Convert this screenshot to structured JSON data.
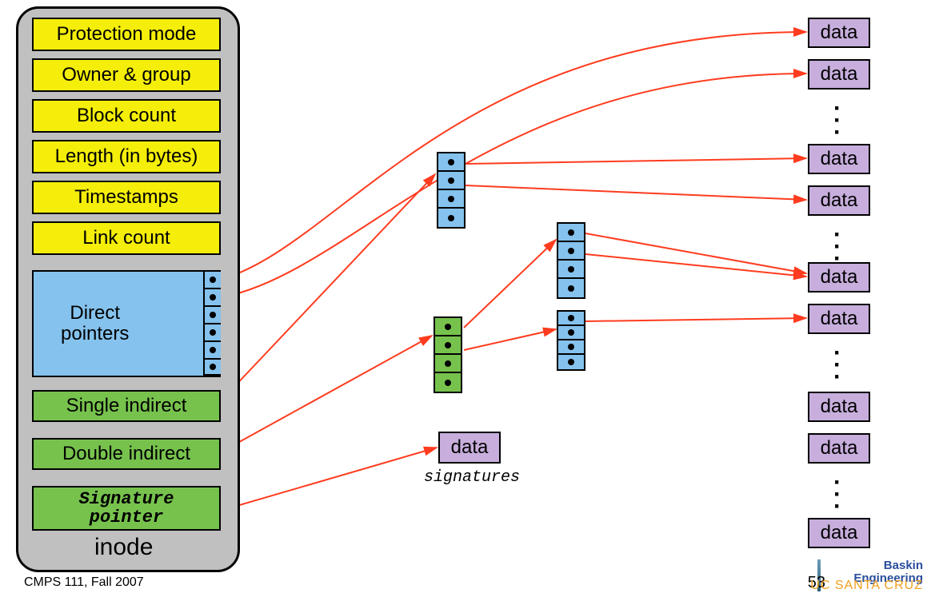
{
  "inode": {
    "title": "inode",
    "metadata": [
      "Protection mode",
      "Owner & group",
      "Block count",
      "Length (in bytes)",
      "Timestamps",
      "Link count"
    ],
    "direct_label": "Direct\npointers",
    "single_indirect": "Single indirect",
    "double_indirect": "Double indirect",
    "signature_ptr": "Signature\npointer"
  },
  "signatures_label": "signatures",
  "data_block_label": "data",
  "footer": {
    "course": "CMPS 111, Fall 2007",
    "page": "53",
    "org1": "Baskin",
    "org2": "Engineering",
    "org3": "UC SANTA CRUZ"
  },
  "chart_data": {
    "type": "diagram",
    "concept": "Unix-style inode with direct, single-indirect, double-indirect, and signature pointers",
    "inode_fields": [
      "Protection mode",
      "Owner & group",
      "Block count",
      "Length (in bytes)",
      "Timestamps",
      "Link count"
    ],
    "direct_pointer_slots_shown": 6,
    "pointer_blocks": [
      {
        "role": "single-indirect",
        "color": "blue",
        "slots": 4,
        "points_to": "data blocks"
      },
      {
        "role": "double-indirect-L1",
        "color": "green",
        "slots": 4,
        "points_to": "single-indirect blocks"
      },
      {
        "role": "double-indirect-L2a",
        "color": "blue",
        "slots": 4,
        "points_to": "data blocks"
      },
      {
        "role": "double-indirect-L2b",
        "color": "blue",
        "slots": 4,
        "points_to": "data blocks"
      }
    ],
    "signature_block": {
      "color": "purple",
      "label": "data",
      "caption": "signatures"
    },
    "right_column_data_blocks_shown": 9,
    "ellipses_groups_on_right": 4,
    "arrows": [
      {
        "from": "direct_ptr[0]",
        "to": "right_data[0]"
      },
      {
        "from": "direct_ptr[1]",
        "to": "right_data[1]"
      },
      {
        "from": "single_indirect_inode",
        "to": "single_indirect_block"
      },
      {
        "from": "single_indirect_block[0]",
        "to": "right_data[3]"
      },
      {
        "from": "single_indirect_block[1]",
        "to": "right_data[4]"
      },
      {
        "from": "double_indirect_inode",
        "to": "double_L1_block"
      },
      {
        "from": "double_L1_block[0]",
        "to": "double_L2a_block"
      },
      {
        "from": "double_L1_block[1]",
        "to": "double_L2b_block"
      },
      {
        "from": "double_L2a_block[0]",
        "to": "right_data[5]"
      },
      {
        "from": "double_L2a_block[1]",
        "to": "right_data[5]"
      },
      {
        "from": "double_L2b_block[0]",
        "to": "right_data[6]"
      },
      {
        "from": "signature_pointer",
        "to": "signatures_data_block"
      }
    ]
  }
}
